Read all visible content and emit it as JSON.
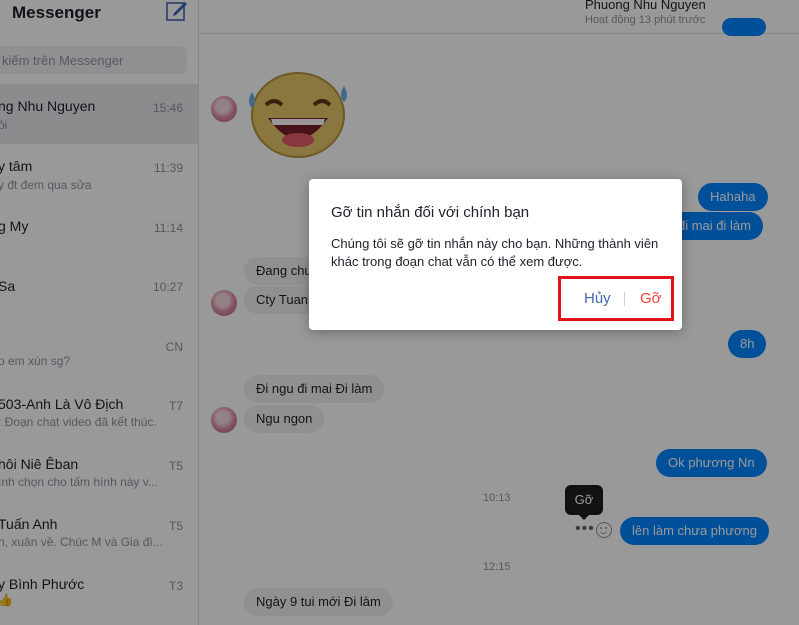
{
  "sidebar": {
    "title": "Messenger",
    "search_placeholder": "kiếm trên Messenger",
    "conversations": [
      {
        "name": "ng Nhu Nguyen",
        "snippet": "ôi",
        "time": "15:46",
        "active": true
      },
      {
        "name": "y tâm",
        "snippet": "y đt đem qua sửa",
        "time": "11:39"
      },
      {
        "name": "g My",
        "snippet": "",
        "time": "11:14"
      },
      {
        "name": "Sa",
        "snippet": "",
        "time": "10:27"
      },
      {
        "name": "",
        "snippet": "o em xún sg?",
        "time": "CN"
      },
      {
        "name": "503-Anh Là Vô Địch",
        "snippet": ": Đoạn chat video đã kết thúc.",
        "time": "T7"
      },
      {
        "name": "hôi Niê Êban",
        "snippet": "ình chọn cho tấm hình này v...",
        "time": "T5"
      },
      {
        "name": "Tuấn Anh",
        "snippet": "n, xuân về. Chúc M và Gia đì...",
        "time": "T5"
      },
      {
        "name": "y Bình Phước",
        "snippet": "👍",
        "time": "T3"
      }
    ]
  },
  "chat": {
    "contact_name": "Phuong Nhu Nguyen",
    "status": "Hoạt động 13 phút trước",
    "messages": {
      "out_hahaha": "Hahaha",
      "out_dimai": "đi mai đi làm",
      "in_dang": "Đang chu",
      "in_cty": "Cty Tuan",
      "out_8h": "8h",
      "in_ngu": "Đi ngu đi mai Đi làm",
      "in_ngungon": "Ngu ngon",
      "out_ok": "Ok phương Nn",
      "out_len": "lên làm chưa phương",
      "in_ngay9": "Ngày 9 tui  mới Đi làm"
    },
    "timestamps": {
      "t1": "10:13",
      "t2": "12:15"
    },
    "tooltip": "Gỡ",
    "dots": "•••"
  },
  "modal": {
    "title": "Gỡ tin nhắn đối với chính bạn",
    "body": "Chúng tôi sẽ gỡ tin nhắn này cho bạn. Những thành viên khác trong đoạn chat vẫn có thể xem được.",
    "cancel_label": "Hủy",
    "remove_label": "Gỡ"
  },
  "colors": {
    "accent": "#0084ff",
    "danger": "#fa3e3e",
    "highlight": "#e0121a",
    "link": "#4267b2"
  },
  "icons": [
    "compose-icon",
    "emoji-icon",
    "avatar",
    "sticker"
  ]
}
